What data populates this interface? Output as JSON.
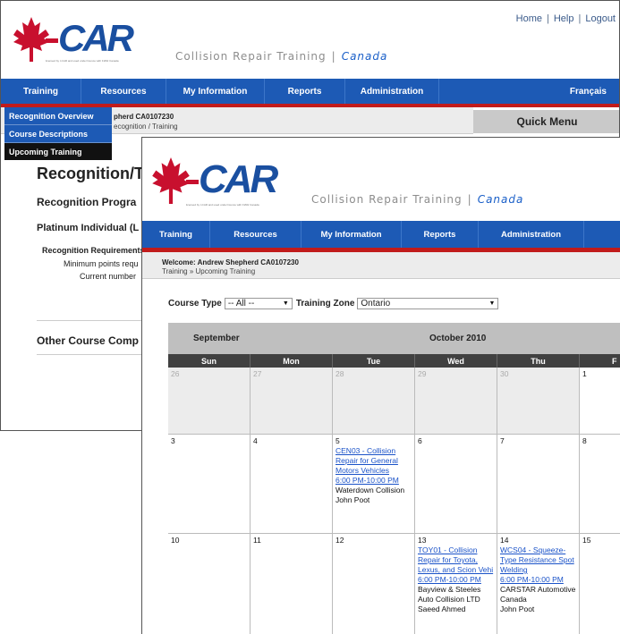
{
  "back": {
    "top_links": [
      "Home",
      "Help",
      "Logout"
    ],
    "logo_text": "I-CAR",
    "logo_fine_print": "licensed by I-CAR and used under licence with FIAW Canada",
    "tagline": "Collision  Repair  Training",
    "country": "Canada",
    "nav": [
      "Training",
      "Resources",
      "My Information",
      "Reports",
      "Administration",
      "Français"
    ],
    "welcome": "Andrew Shepherd CA0107230",
    "welcome_visible": "pherd  CA0107230",
    "breadcrumb_visible": "ecognition  /  Training",
    "quick_menu": "Quick Menu",
    "dropdown": [
      "Recognition Overview",
      "Course Descriptions",
      "Upcoming Training"
    ],
    "heading": "Recognition/T",
    "program": "Recognition Progra",
    "level": "Platinum Individual (L",
    "requirements": "Recognition Requirements",
    "min_points": "Minimum points requ",
    "current_number": "Current number",
    "other": "Other Course Comp"
  },
  "front": {
    "logo_text": "I-CAR",
    "logo_fine_print": "licensed by I-CAR and used under licence with FIAW Canada",
    "tagline": "Collision  Repair  Training",
    "country": "Canada",
    "nav": [
      "Training",
      "Resources",
      "My Information",
      "Reports",
      "Administration"
    ],
    "welcome": "Welcome:  Andrew  Shepherd  CA0107230",
    "breadcrumb": "Training  »  Upcoming  Training",
    "filters": {
      "course_type_label": "Course Type",
      "course_type_value": "-- All --",
      "zone_label": "Training Zone",
      "zone_value": "Ontario"
    },
    "calendar": {
      "prev_month": "September",
      "current_month": "October 2010",
      "days": [
        "Sun",
        "Mon",
        "Tue",
        "Wed",
        "Thu",
        "F"
      ],
      "weeks": [
        [
          {
            "day": "26",
            "muted": true
          },
          {
            "day": "27",
            "muted": true
          },
          {
            "day": "28",
            "muted": true
          },
          {
            "day": "29",
            "muted": true
          },
          {
            "day": "30",
            "muted": true
          },
          {
            "day": "1"
          }
        ],
        [
          {
            "day": "3"
          },
          {
            "day": "4"
          },
          {
            "day": "5",
            "course": "CEN03 - Collision Repair for General Motors Vehicles",
            "time": "6:00 PM-10:00 PM",
            "location": "Waterdown Collision",
            "instructor": "John Poot"
          },
          {
            "day": "6"
          },
          {
            "day": "7"
          },
          {
            "day": "8"
          }
        ],
        [
          {
            "day": "10"
          },
          {
            "day": "11"
          },
          {
            "day": "12"
          },
          {
            "day": "13",
            "course": "TOY01 - Collision Repair for Toyota, Lexus, and Scion Vehi",
            "time": "6:00 PM-10:00 PM",
            "location": "Bayview & Steeles Auto Collision LTD",
            "instructor": "Saeed Ahmed"
          },
          {
            "day": "14",
            "course": "WCS04 - Squeeze-Type Resistance Spot Welding",
            "time": "6:00 PM-10:00 PM",
            "location": "CARSTAR Automotive Canada",
            "instructor": "John Poot"
          },
          {
            "day": "15"
          }
        ]
      ]
    }
  },
  "colors": {
    "nav_blue": "#1d5ab5",
    "accent_red": "#c11b1b",
    "link_blue": "#1a52c8",
    "brand_red": "#c8102e"
  }
}
